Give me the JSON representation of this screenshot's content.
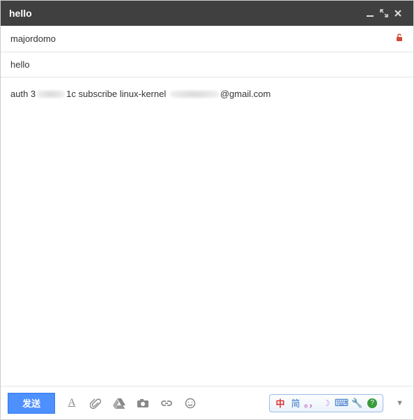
{
  "titlebar": {
    "title": "hello"
  },
  "fields": {
    "to": "majordomo",
    "subject": "hello"
  },
  "body": {
    "prefix": "auth 3",
    "mid": "1c subscribe linux-kernel",
    "suffix": "@gmail.com"
  },
  "toolbar": {
    "send_label": "发送"
  },
  "ime": {
    "zhong": "中",
    "jian": "简"
  }
}
